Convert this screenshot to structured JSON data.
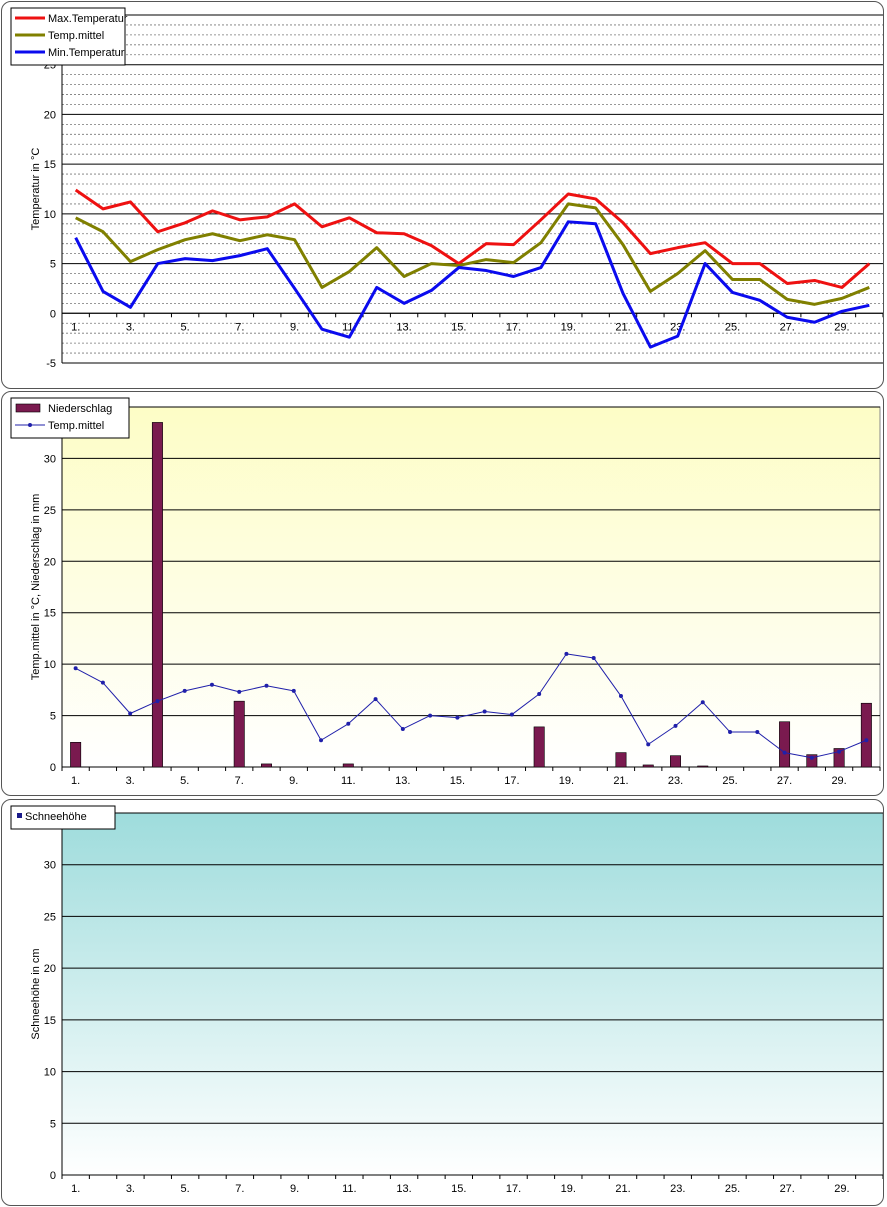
{
  "chart_data": [
    {
      "type": "line",
      "ylabel": "Temperatur in °C",
      "ylim": [
        -5,
        30
      ],
      "yticks": [
        -5,
        0,
        5,
        10,
        15,
        20,
        25
      ],
      "x": [
        1,
        2,
        3,
        4,
        5,
        6,
        7,
        8,
        9,
        10,
        11,
        12,
        13,
        14,
        15,
        16,
        17,
        18,
        19,
        20,
        21,
        22,
        23,
        24,
        25,
        26,
        27,
        28,
        29,
        30
      ],
      "xtick_labels": [
        "1.",
        "3.",
        "5.",
        "7.",
        "9.",
        "11.",
        "13.",
        "15.",
        "17.",
        "19.",
        "21.",
        "23.",
        "25.",
        "27.",
        "29."
      ],
      "legend": "top-left",
      "grid": true,
      "series": [
        {
          "name": "Max.Temperatur",
          "color": "#ee1111",
          "values": [
            12.4,
            10.5,
            11.2,
            8.2,
            9.1,
            10.3,
            9.4,
            9.7,
            11.0,
            8.7,
            9.6,
            8.1,
            8.0,
            6.8,
            5.0,
            7.0,
            6.9,
            9.4,
            12.0,
            11.5,
            9.1,
            6.0,
            6.6,
            7.1,
            5.0,
            5.0,
            3.0,
            3.3,
            2.6,
            5.0
          ]
        },
        {
          "name": "Temp.mittel",
          "color": "#808000",
          "values": [
            9.6,
            8.2,
            5.2,
            6.4,
            7.4,
            8.0,
            7.3,
            7.9,
            7.4,
            2.6,
            4.2,
            6.6,
            3.7,
            5.0,
            4.8,
            5.4,
            5.1,
            7.1,
            11.0,
            10.6,
            6.9,
            2.2,
            4.0,
            6.3,
            3.4,
            3.4,
            1.4,
            0.9,
            1.5,
            2.6
          ]
        },
        {
          "name": "Min.Temperatur",
          "color": "#0b0bee",
          "values": [
            7.6,
            2.2,
            0.6,
            5.0,
            5.5,
            5.3,
            5.8,
            6.5,
            2.5,
            -1.6,
            -2.4,
            2.6,
            1.0,
            2.3,
            4.6,
            4.3,
            3.7,
            4.6,
            9.2,
            9.0,
            2.0,
            -3.4,
            -2.3,
            5.0,
            2.1,
            1.3,
            -0.4,
            -0.9,
            0.2,
            0.8
          ]
        }
      ]
    },
    {
      "type": "bar",
      "ylabel": "Temp.mittel  in °C, Niederschlag in mm",
      "ylim": [
        0,
        35
      ],
      "yticks": [
        0,
        5,
        10,
        15,
        20,
        25,
        30
      ],
      "x": [
        1,
        2,
        3,
        4,
        5,
        6,
        7,
        8,
        9,
        10,
        11,
        12,
        13,
        14,
        15,
        16,
        17,
        18,
        19,
        20,
        21,
        22,
        23,
        24,
        25,
        26,
        27,
        28,
        29,
        30
      ],
      "xtick_labels": [
        "1.",
        "3.",
        "5.",
        "7.",
        "9.",
        "11.",
        "13.",
        "15.",
        "17.",
        "19.",
        "21.",
        "23.",
        "25.",
        "27.",
        "29."
      ],
      "legend": "top-left",
      "grid": true,
      "series": [
        {
          "name": "Niederschlag",
          "kind": "bar",
          "color": "#7a1a4f",
          "values": [
            2.4,
            0,
            0,
            33.5,
            0,
            0,
            6.4,
            0.3,
            0,
            0,
            0.3,
            0,
            0,
            0,
            0,
            0,
            0,
            3.9,
            0,
            0,
            1.4,
            0.2,
            1.1,
            0.1,
            0,
            0,
            4.4,
            1.2,
            1.8,
            6.2
          ]
        },
        {
          "name": "Temp.mittel",
          "kind": "line",
          "color": "#2020aa",
          "values": [
            9.6,
            8.2,
            5.2,
            6.4,
            7.4,
            8.0,
            7.3,
            7.9,
            7.4,
            2.6,
            4.2,
            6.6,
            3.7,
            5.0,
            4.8,
            5.4,
            5.1,
            7.1,
            11.0,
            10.6,
            6.9,
            2.2,
            4.0,
            6.3,
            3.4,
            3.4,
            1.4,
            0.9,
            1.5,
            2.6
          ]
        }
      ]
    },
    {
      "type": "bar",
      "ylabel": "Schneehöhe in cm",
      "ylim": [
        0,
        35
      ],
      "yticks": [
        0,
        5,
        10,
        15,
        20,
        25,
        30
      ],
      "x": [
        1,
        2,
        3,
        4,
        5,
        6,
        7,
        8,
        9,
        10,
        11,
        12,
        13,
        14,
        15,
        16,
        17,
        18,
        19,
        20,
        21,
        22,
        23,
        24,
        25,
        26,
        27,
        28,
        29,
        30
      ],
      "xtick_labels": [
        "1.",
        "3.",
        "5.",
        "7.",
        "9.",
        "11.",
        "13.",
        "15.",
        "17.",
        "19.",
        "21.",
        "23.",
        "25.",
        "27.",
        "29."
      ],
      "legend": "top-left",
      "grid": true,
      "series": [
        {
          "name": "Schneehöhe",
          "kind": "bar",
          "color": "#1a1a8a",
          "values": [
            0,
            0,
            0,
            0,
            0,
            0,
            0,
            0,
            0,
            0,
            0,
            0,
            0,
            0,
            0,
            0,
            0,
            0,
            0,
            0,
            0,
            0,
            0,
            0,
            0,
            0,
            0,
            0,
            0,
            0
          ]
        }
      ]
    }
  ]
}
